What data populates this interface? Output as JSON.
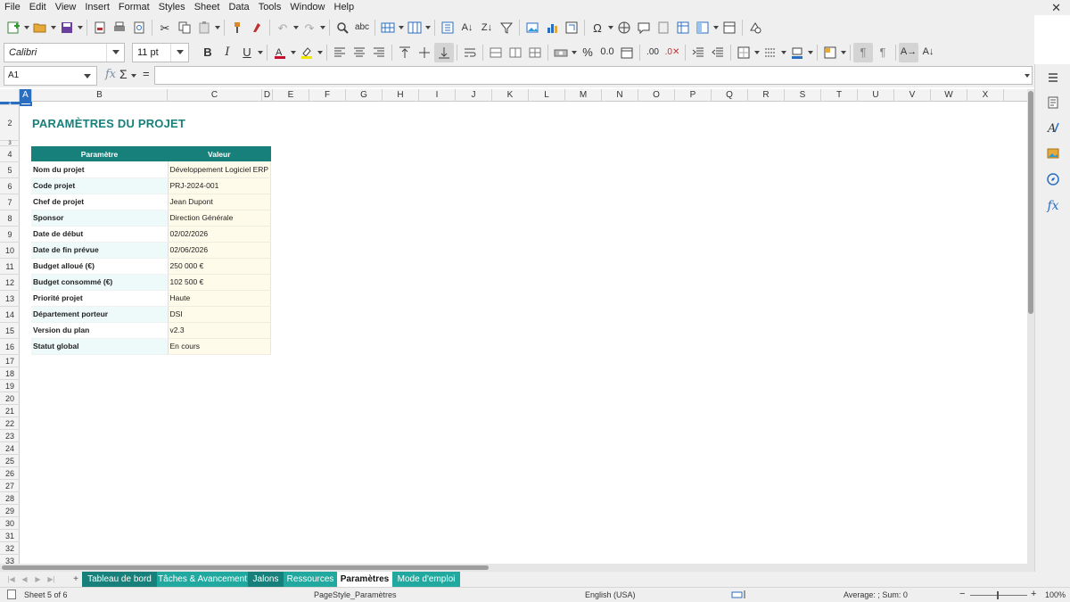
{
  "menu": [
    "File",
    "Edit",
    "View",
    "Insert",
    "Format",
    "Styles",
    "Sheet",
    "Data",
    "Tools",
    "Window",
    "Help"
  ],
  "font": {
    "name": "Calibri",
    "size": "11 pt"
  },
  "name_box": "A1",
  "columns": [
    "A",
    "B",
    "C",
    "D",
    "E",
    "F",
    "G",
    "H",
    "I",
    "J",
    "K",
    "L",
    "M",
    "N",
    "O",
    "P",
    "Q",
    "R",
    "S",
    "T",
    "U",
    "V",
    "W",
    "X"
  ],
  "rows": [
    "1",
    "2",
    "3",
    "4",
    "5",
    "6",
    "7",
    "8",
    "9",
    "10",
    "11",
    "12",
    "13",
    "14",
    "15",
    "16",
    "17",
    "18",
    "19",
    "20",
    "21",
    "22",
    "23",
    "24",
    "25",
    "26",
    "27",
    "28",
    "29",
    "30",
    "31",
    "32",
    "33"
  ],
  "sheet_title": "PARAMÈTRES DU PROJET",
  "table": {
    "headers": [
      "Paramètre",
      "Valeur"
    ],
    "rows": [
      [
        "Nom du projet",
        "Développement Logiciel ERP"
      ],
      [
        "Code projet",
        "PRJ-2024-001"
      ],
      [
        "Chef de projet",
        "Jean Dupont"
      ],
      [
        "Sponsor",
        "Direction Générale"
      ],
      [
        "Date de début",
        "02/02/2026"
      ],
      [
        "Date de fin prévue",
        "02/06/2026"
      ],
      [
        "Budget alloué (€)",
        "250 000 €"
      ],
      [
        "Budget consommé (€)",
        "102 500 €"
      ],
      [
        "Priorité projet",
        "Haute"
      ],
      [
        "Département porteur",
        "DSI"
      ],
      [
        "Version du plan",
        "v2.3"
      ],
      [
        "Statut global",
        "En cours"
      ]
    ]
  },
  "tabs": [
    {
      "label": "Tableau de bord",
      "color": "#17807a"
    },
    {
      "label": "Tâches & Avancement",
      "color": "#21a99f"
    },
    {
      "label": "Jalons",
      "color": "#17807a"
    },
    {
      "label": "Ressources",
      "color": "#21a99f"
    },
    {
      "label": "Paramètres",
      "color": "#ffffff"
    },
    {
      "label": "Mode d'emploi",
      "color": "#21a99f"
    }
  ],
  "status": {
    "sheet": "Sheet 5 of 6",
    "page_style": "PageStyle_Paramètres",
    "language": "English (USA)",
    "summary": "Average: ; Sum: 0",
    "zoom": "100%"
  },
  "colors": {
    "accent": "#17807a",
    "selection": "#2a6ec2"
  }
}
